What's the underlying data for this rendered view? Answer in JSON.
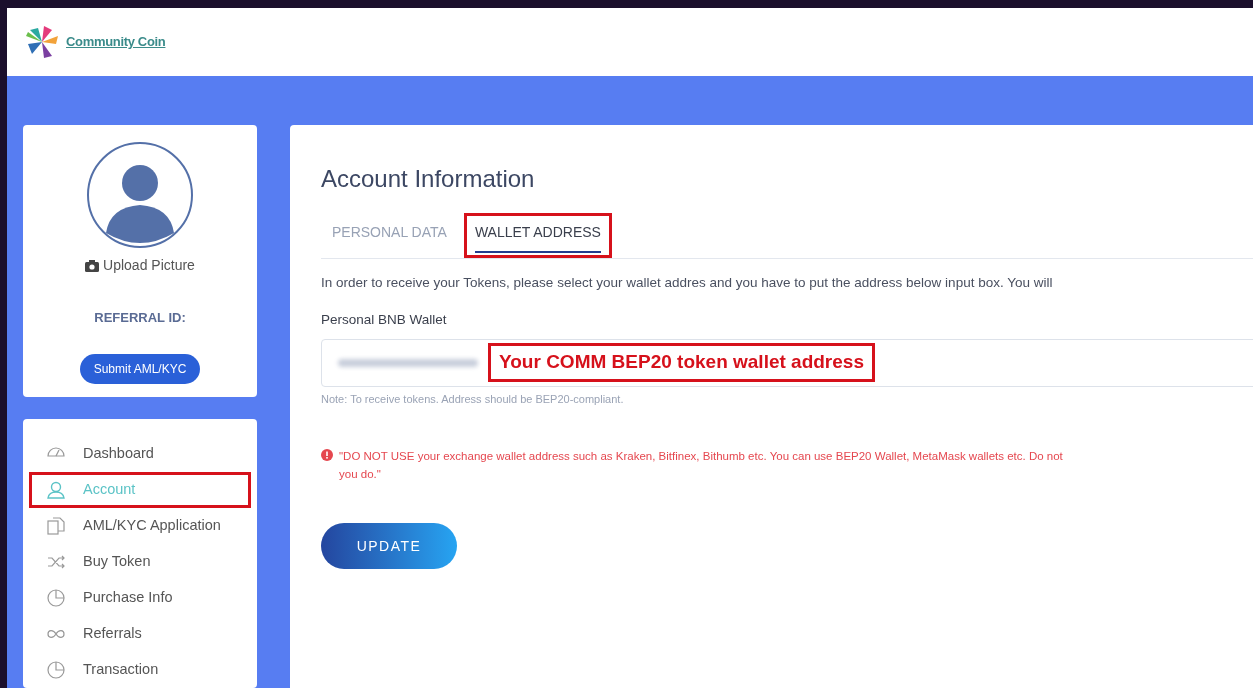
{
  "header": {
    "logo_text": "Community Coin"
  },
  "profile": {
    "upload_label": "Upload Picture",
    "referral_label": "REFERRAL ID:",
    "submit_button": "Submit AML/KYC"
  },
  "nav": [
    {
      "kind": "gauge",
      "label": "Dashboard",
      "selected": false,
      "highlighted": false
    },
    {
      "kind": "user",
      "label": "Account",
      "selected": true,
      "highlighted": true
    },
    {
      "kind": "docs",
      "label": "AML/KYC Application",
      "selected": false,
      "highlighted": false
    },
    {
      "kind": "shuffle",
      "label": "Buy Token",
      "selected": false,
      "highlighted": false
    },
    {
      "kind": "pie",
      "label": "Purchase Info",
      "selected": false,
      "highlighted": false
    },
    {
      "kind": "infinity",
      "label": "Referrals",
      "selected": false,
      "highlighted": false
    },
    {
      "kind": "pie",
      "label": "Transaction",
      "selected": false,
      "highlighted": false
    }
  ],
  "main": {
    "title": "Account Information",
    "tabs": [
      {
        "label": "PERSONAL DATA",
        "selected": false,
        "highlighted": false
      },
      {
        "label": "WALLET ADDRESS",
        "selected": true,
        "highlighted": true
      }
    ],
    "intro": "In order to receive your Tokens, please select your wallet addres and you have to put the address below input box. You will",
    "field_label": "Personal BNB Wallet",
    "field_callout": "Your COMM BEP20 token wallet address",
    "note": "Note: To receive tokens. Address should be BEP20-compliant.",
    "warning_lines": [
      "\"DO NOT USE your exchange wallet address such as Kraken, Bitfinex, Bithumb etc. You can use BEP20 Wallet, MetaMask wallets etc. Do not",
      "you do.\""
    ],
    "update_button": "UPDATE"
  }
}
